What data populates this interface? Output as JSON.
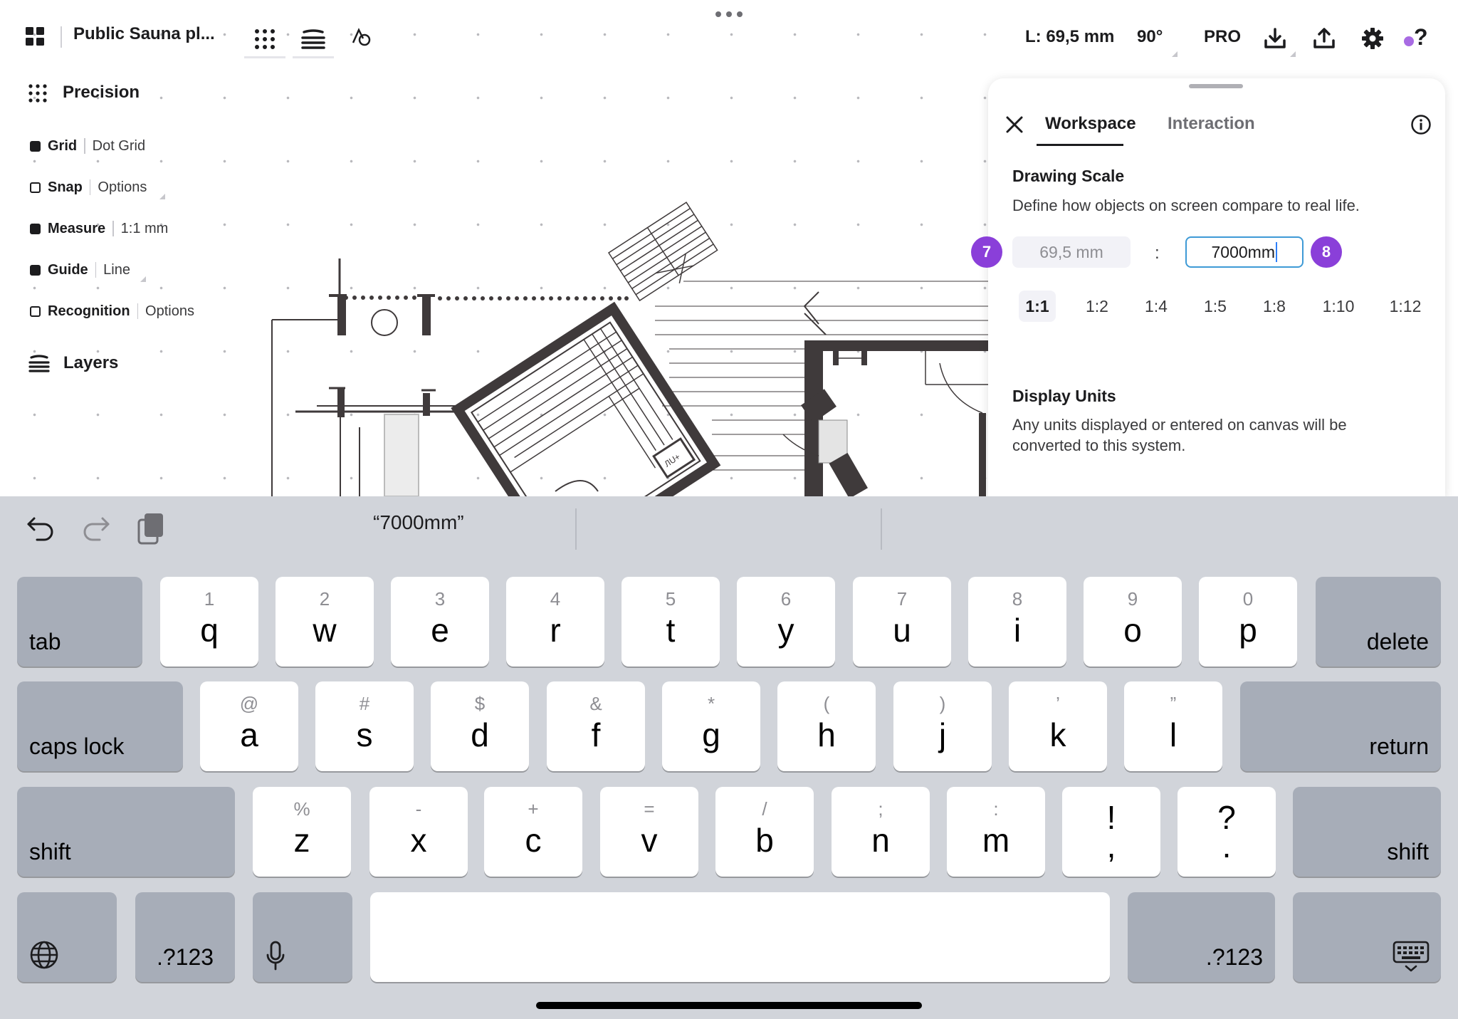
{
  "app": {
    "document_title": "Public Sauna pl...",
    "icons": {
      "apps": "grid-apps-icon",
      "precision": "dots-grid-icon",
      "layers": "layers-icon",
      "shapes": "shapes-icon",
      "download": "download-icon",
      "upload": "upload-icon",
      "settings": "gear-icon",
      "help": "help-icon",
      "more": "ellipsis-icon"
    },
    "status": {
      "length": "L: 69,5 mm",
      "angle": "90°"
    },
    "pro_label": "PRO",
    "help_label": "?",
    "accent_color": "#8a3fd9"
  },
  "left_panel": {
    "precision_title": "Precision",
    "items": [
      {
        "label": "Grid",
        "value": "Dot Grid",
        "enabled": true
      },
      {
        "label": "Snap",
        "value": "Options",
        "enabled": false
      },
      {
        "label": "Measure",
        "value": "1:1 mm",
        "enabled": true
      },
      {
        "label": "Guide",
        "value": "Line",
        "enabled": true
      },
      {
        "label": "Recognition",
        "value": "Options",
        "enabled": false
      }
    ],
    "layers_title": "Layers"
  },
  "settings_panel": {
    "tabs": [
      {
        "label": "Workspace",
        "active": true
      },
      {
        "label": "Interaction",
        "active": false
      }
    ],
    "drawing_scale": {
      "title": "Drawing Scale",
      "description": "Define how objects on screen compare to real life.",
      "screen_value": "69,5 mm",
      "separator": ":",
      "real_value": "7000mm",
      "badge_left": "7",
      "badge_right": "8",
      "presets": [
        "1:1",
        "1:2",
        "1:4",
        "1:5",
        "1:8",
        "1:10",
        "1:12"
      ],
      "selected_preset": "1:1"
    },
    "display_units": {
      "title": "Display Units",
      "description_line1": "Any units displayed or entered on canvas will be",
      "description_line2": "converted to this system."
    }
  },
  "keyboard": {
    "suggestion": "“7000mm”",
    "row1": [
      {
        "k": "q",
        "s": "1"
      },
      {
        "k": "w",
        "s": "2"
      },
      {
        "k": "e",
        "s": "3"
      },
      {
        "k": "r",
        "s": "4"
      },
      {
        "k": "t",
        "s": "5"
      },
      {
        "k": "y",
        "s": "6"
      },
      {
        "k": "u",
        "s": "7"
      },
      {
        "k": "i",
        "s": "8"
      },
      {
        "k": "o",
        "s": "9"
      },
      {
        "k": "p",
        "s": "0"
      }
    ],
    "row2": [
      {
        "k": "a",
        "s": "@"
      },
      {
        "k": "s",
        "s": "#"
      },
      {
        "k": "d",
        "s": "$"
      },
      {
        "k": "f",
        "s": "&"
      },
      {
        "k": "g",
        "s": "*"
      },
      {
        "k": "h",
        "s": "("
      },
      {
        "k": "j",
        "s": ")"
      },
      {
        "k": "k",
        "s": "’"
      },
      {
        "k": "l",
        "s": "”"
      }
    ],
    "row3": [
      {
        "k": "z",
        "s": "%"
      },
      {
        "k": "x",
        "s": "-"
      },
      {
        "k": "c",
        "s": "+"
      },
      {
        "k": "v",
        "s": "="
      },
      {
        "k": "b",
        "s": "/"
      },
      {
        "k": "n",
        "s": ";"
      },
      {
        "k": "m",
        "s": ":"
      },
      {
        "k": ",",
        "s": "!"
      },
      {
        "k": ".",
        "s": "?"
      }
    ],
    "tab": "tab",
    "delete": "delete",
    "caps_lock": "caps lock",
    "return": "return",
    "shift": "shift",
    "numbers": ".?123"
  }
}
